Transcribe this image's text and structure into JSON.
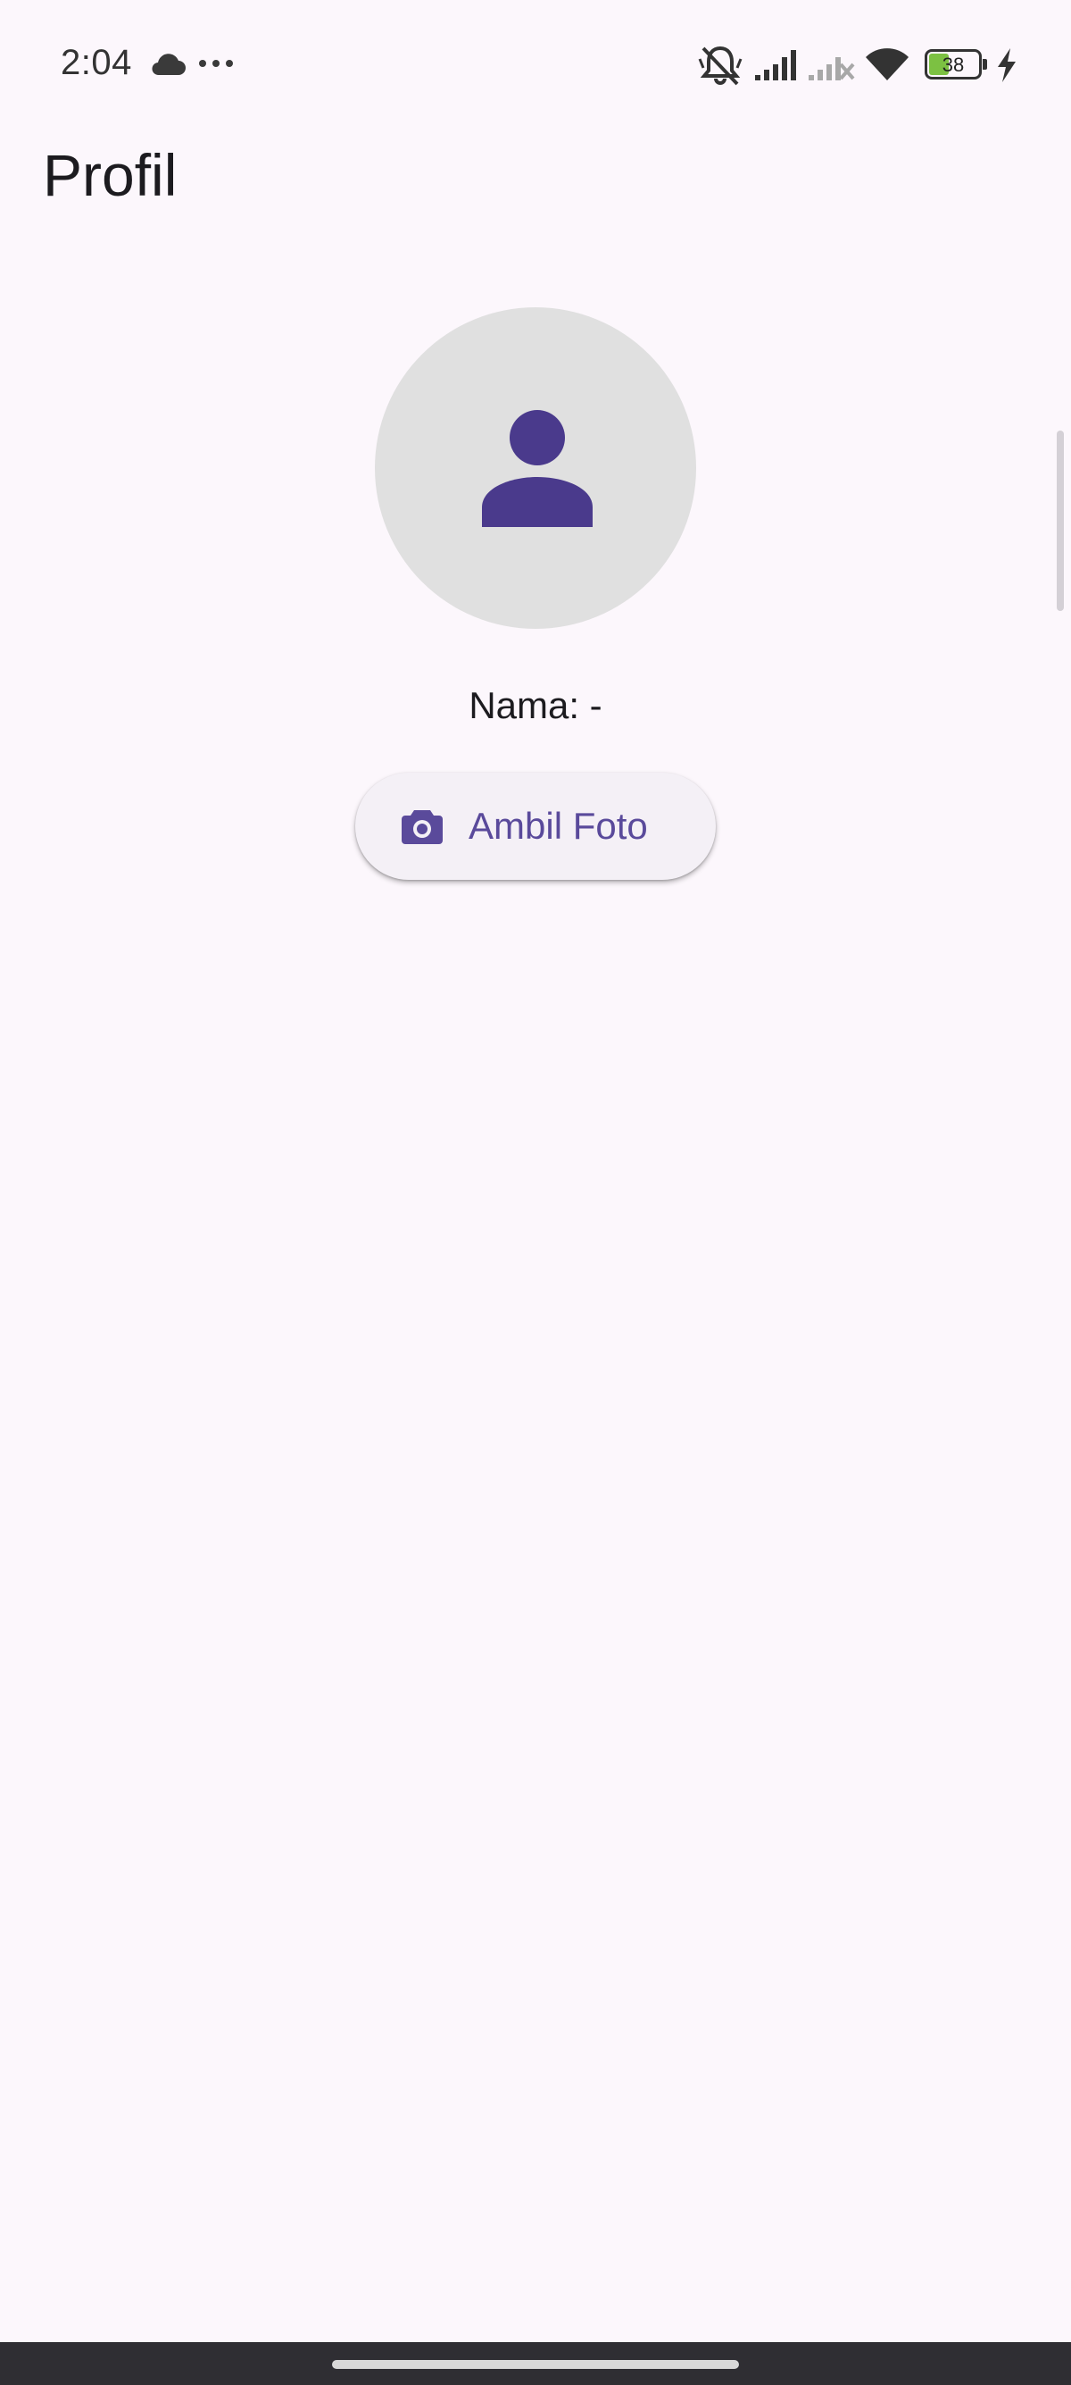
{
  "status_bar": {
    "time": "2:04",
    "battery_level": "38",
    "icons": [
      "cloud-icon",
      "more-dots-icon",
      "silent-mode-icon",
      "signal-icon",
      "signal-no-service-icon",
      "wifi-icon",
      "battery-icon",
      "charging-icon"
    ]
  },
  "app_bar": {
    "title": "Profil"
  },
  "profile": {
    "avatar_icon": "person-icon",
    "name_label": "Nama: -"
  },
  "actions": {
    "take_photo_label": "Ambil Foto",
    "take_photo_icon": "camera-icon"
  },
  "colors": {
    "background": "#FCF7FC",
    "accent": "#4A3A8C",
    "button_bg": "#F4F0F6",
    "button_text": "#5A4A9B",
    "avatar_bg": "#E0E0E0",
    "nav_bar": "#2F2E33"
  }
}
